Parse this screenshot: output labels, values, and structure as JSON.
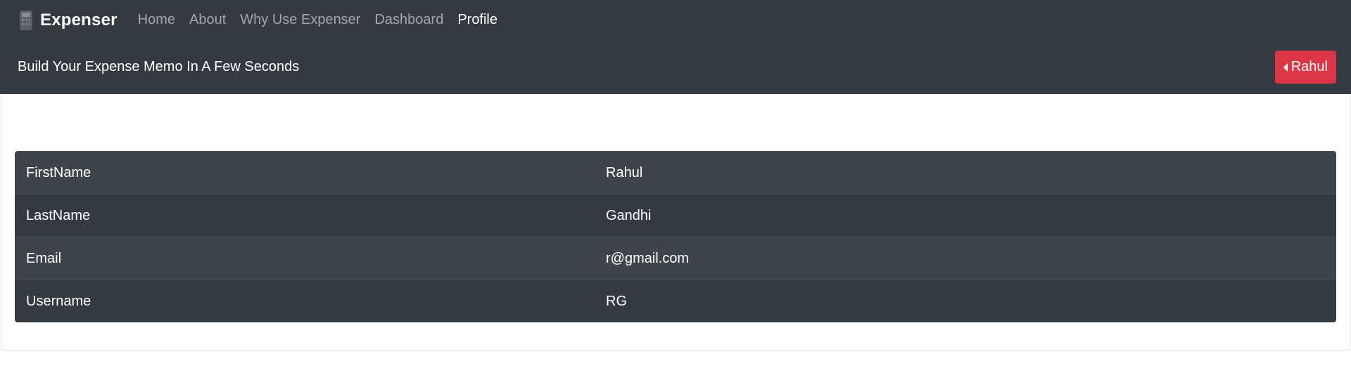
{
  "brand": {
    "name": "Expenser",
    "icon": "calculator-icon"
  },
  "nav": {
    "links": [
      {
        "label": "Home",
        "active": false
      },
      {
        "label": "About",
        "active": false
      },
      {
        "label": "Why Use Expenser",
        "active": false
      },
      {
        "label": "Dashboard",
        "active": false
      },
      {
        "label": "Profile",
        "active": true
      }
    ]
  },
  "header": {
    "tagline": "Build Your Expense Memo In A Few Seconds",
    "user_button_label": "Rahul",
    "user_button_icon": "caret-left-icon"
  },
  "profile": {
    "rows": [
      {
        "label": "FirstName",
        "value": "Rahul"
      },
      {
        "label": "LastName",
        "value": "Gandhi"
      },
      {
        "label": "Email",
        "value": "r@gmail.com"
      },
      {
        "label": "Username",
        "value": "RG"
      }
    ]
  },
  "colors": {
    "navbar_bg": "#343a40",
    "button_danger": "#dc3545",
    "row_odd": "#3f444a",
    "row_even": "#343a40"
  }
}
